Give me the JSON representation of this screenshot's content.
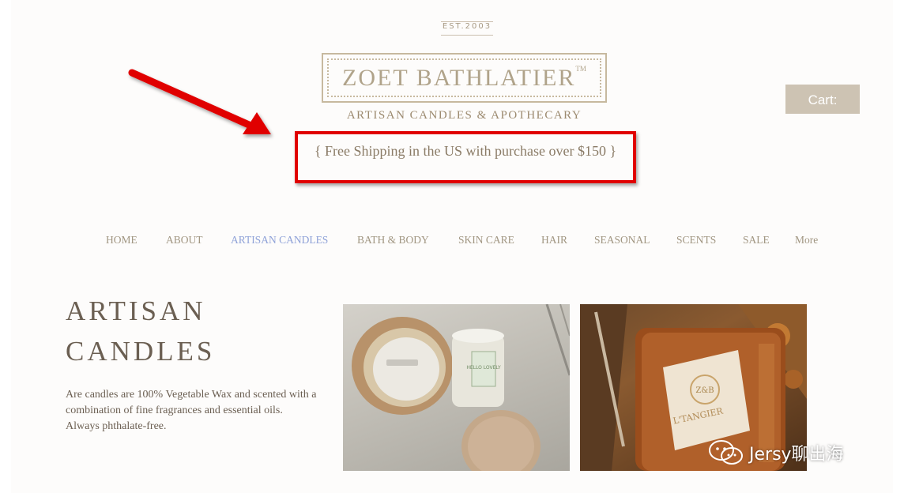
{
  "header": {
    "established": "EST.2003",
    "brand_name": "ZOET BATHLATIER",
    "trademark": "TM",
    "tagline": "ARTISAN CANDLES & APOTHECARY",
    "cart_label": "Cart:"
  },
  "promo": {
    "shipping_text": "{ Free Shipping in the US with purchase over $150 }"
  },
  "nav": {
    "items": [
      {
        "label": "HOME"
      },
      {
        "label": "ABOUT"
      },
      {
        "label": "ARTISAN CANDLES",
        "active": true
      },
      {
        "label": "BATH & BODY"
      },
      {
        "label": "SKIN CARE"
      },
      {
        "label": "HAIR"
      },
      {
        "label": "SEASONAL"
      },
      {
        "label": "SCENTS"
      },
      {
        "label": "SALE"
      },
      {
        "label": "More"
      }
    ]
  },
  "main": {
    "title_line1": "ARTISAN",
    "title_line2": "CANDLES",
    "description": "Are candles are 100% Vegetable Wax and scented with a combination of fine fragrances and essential oils. Always phthalate-free.",
    "products": [
      {
        "image_label": "HELLO LOVELY"
      },
      {
        "image_label": "L'TANGIER",
        "logo": "Z&B"
      }
    ]
  },
  "watermark": {
    "text": "Jersy聊出海"
  },
  "colors": {
    "annotation_red": "#e00000",
    "brand_beige": "#c7b99f",
    "nav_active": "#8fa2d8",
    "cart_bg": "#cdc3b3"
  }
}
